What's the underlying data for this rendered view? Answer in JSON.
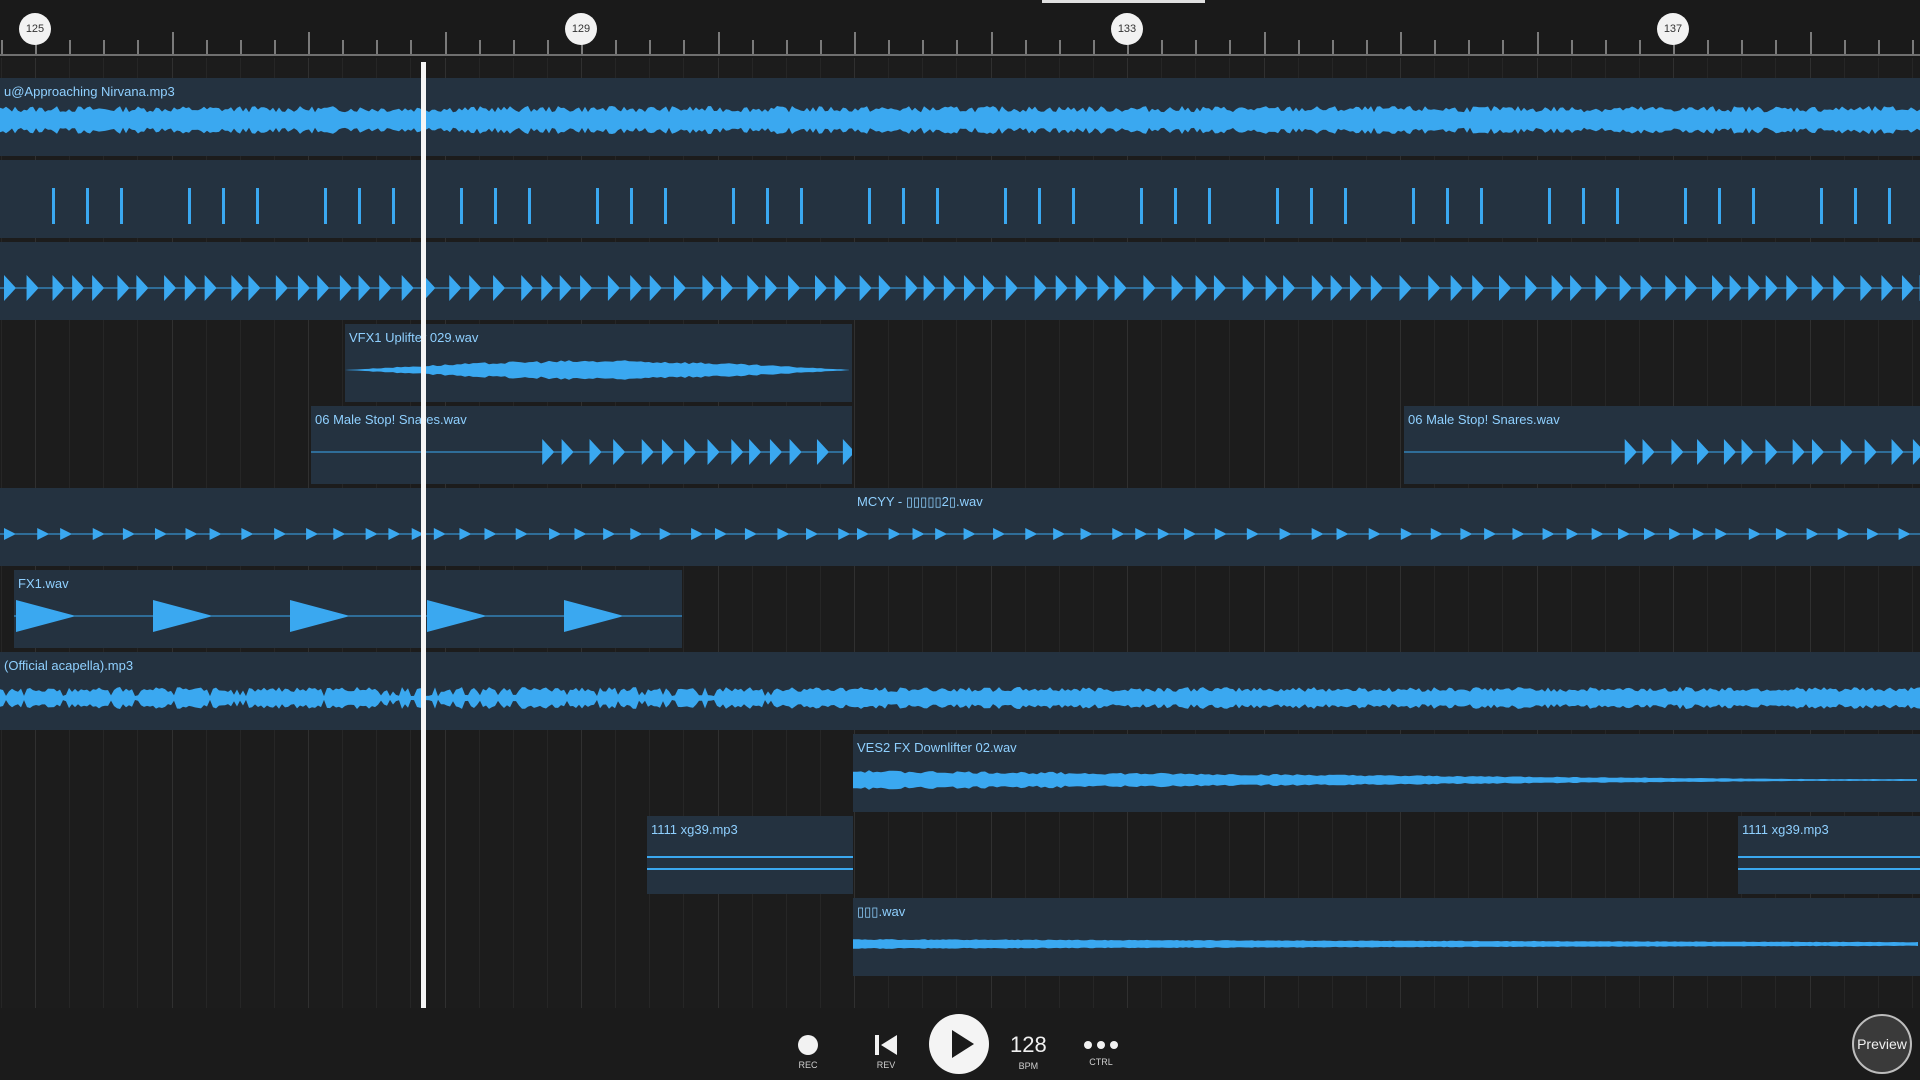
{
  "ruler": {
    "markers": [
      "125",
      "129",
      "133",
      "137"
    ]
  },
  "transport": {
    "rec_label": "REC",
    "rev_label": "REV",
    "bpm_value": "128",
    "bpm_label": "BPM",
    "ctrl_label": "CTRL",
    "preview_label": "Preview"
  },
  "clips": {
    "nirvana": "u@Approaching Nirvana.mp3",
    "uplifter": "VFX1 Uplifter 029.wav",
    "snares_a": "06 Male Stop! Snares.wav",
    "snares_b": "06 Male Stop! Snares.wav",
    "mcyy": "MCYY - ▯▯▯▯▯2▯.wav",
    "fx1": "FX1.wav",
    "acapella": "(Official acapella).mp3",
    "downlifter": "VES2 FX Downlifter 02.wav",
    "xg39_a": "1111 xg39.mp3",
    "xg39_b": "1111 xg39.mp3",
    "wav": "▯▯▯.wav"
  },
  "colors": {
    "waveform": "#3aa8f0",
    "clip_bg": "#243240",
    "clip_label": "#8fd0ff",
    "playhead": "#f5f5f5"
  },
  "playhead_bar": 127.8
}
